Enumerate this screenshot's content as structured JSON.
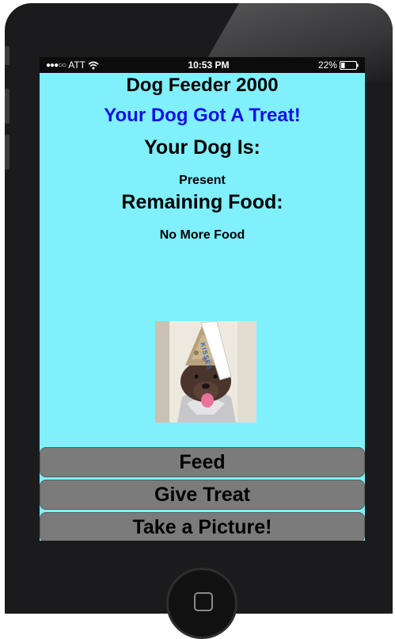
{
  "status_bar": {
    "carrier": "ATT",
    "signal_dots": "●●●○○",
    "time": "10:53 PM",
    "battery": "22%"
  },
  "app": {
    "title": "Dog Feeder 2000",
    "alert": "Your Dog Got A Treat!",
    "status_heading": "Your Dog Is:",
    "status_value": "Present",
    "food_heading": "Remaining Food:",
    "food_value": "No More Food"
  },
  "buttons": {
    "feed": "Feed",
    "treat": "Give Treat",
    "picture": "Take a Picture!"
  },
  "photo": {
    "hat_text": "KISSES"
  },
  "colors": {
    "screen_bg": "#80f0fd",
    "alert_text": "#1212e6",
    "button_bg": "#7b7b7b"
  }
}
